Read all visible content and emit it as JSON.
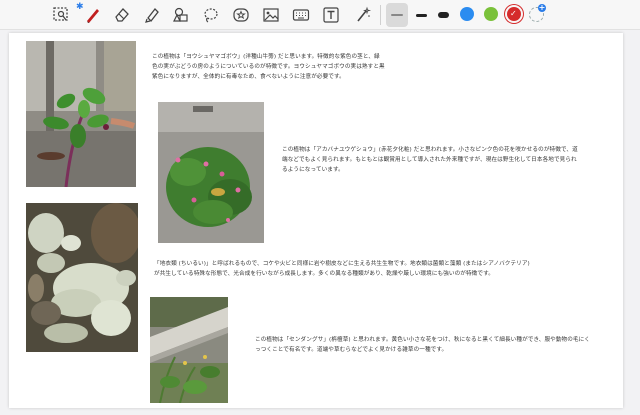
{
  "toolbar": {
    "tools": [
      {
        "name": "lasso-select",
        "icon": "lasso-select-icon"
      },
      {
        "name": "pen",
        "icon": "pen-icon"
      },
      {
        "name": "eraser",
        "icon": "eraser-icon"
      },
      {
        "name": "highlighter",
        "icon": "highlighter-icon"
      },
      {
        "name": "shapes",
        "icon": "shapes-icon"
      },
      {
        "name": "lasso",
        "icon": "lasso-icon"
      },
      {
        "name": "sticker",
        "icon": "sticker-icon"
      },
      {
        "name": "image",
        "icon": "image-icon"
      },
      {
        "name": "keyboard",
        "icon": "keyboard-icon"
      },
      {
        "name": "text-box",
        "icon": "text-box-icon"
      },
      {
        "name": "magic",
        "icon": "magic-wand-icon"
      }
    ],
    "bluetooth_glyph": "✱",
    "colors": [
      "#2b8cf0",
      "#7ac13a",
      "#d52b2b"
    ],
    "active_color": "#d52b2b",
    "add_plus": "+"
  },
  "page": {
    "para1": "この植物は「ヨウシュヤマゴボウ」(洋種山牛蒡) だと思います。特徴的な紫色の茎と、緑色の実がぶどうの房のようについているのが特徴です。ヨウシュヤマゴボウの実は熟すと黒紫色になりますが、全体的に有毒なため、食べないように注意が必要です。",
    "para2": "この植物は「アカバナユウゲショウ」(赤花夕化粧) だと思われます。小さなピンク色の花を咲かせるのが特徴で、道端などでもよく見られます。もともとは観賞用として導入された外来種ですが、現在は野生化して日本各地で見られるようになっています。",
    "para3": "「地衣類 (ちいるい)」と呼ばれるもので、コケや火ビと同様に岩や樹皮などに生える共生生物です。地衣類は菌類と藻類 (またはシアノバクテリア) が共生している特殊な形態で、光合成を行いながら成長します。多くの異なる種類があり、乾燥や厳しい環境にも強いのが特徴です。",
    "para4": "この植物は「センダングサ」(栴檀草) と思われます。黄色い小さな花をつけ、秋になると黒くて細長い種ができ、服や動物の毛にくっつくことで有名です。道端や草むらなどでよく見かける雑草の一種です。"
  }
}
